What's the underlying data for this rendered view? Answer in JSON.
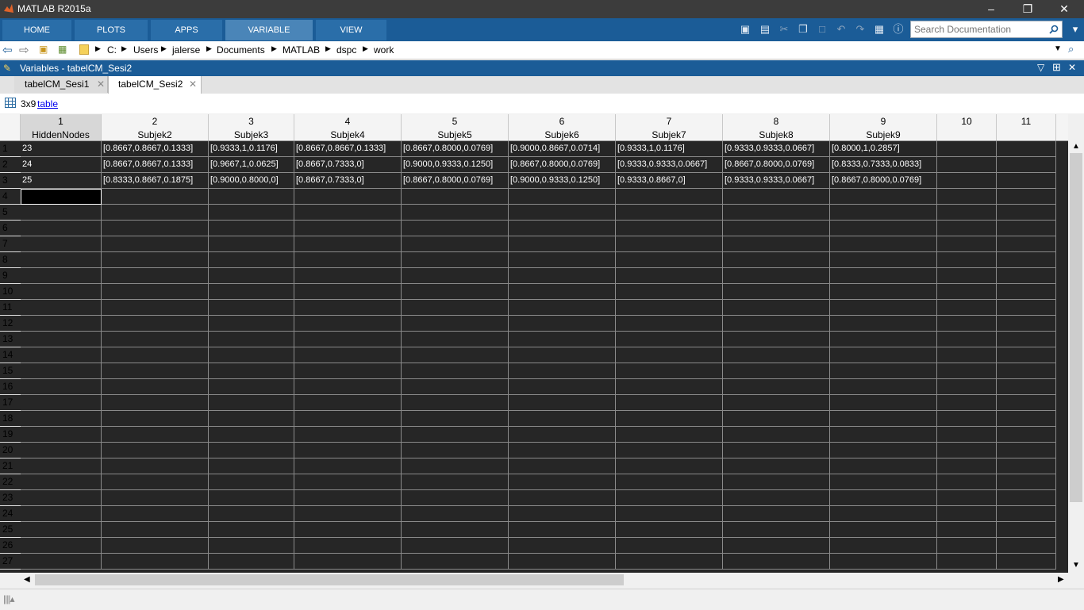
{
  "window": {
    "title": "MATLAB R2015a"
  },
  "ribbon": {
    "tabs": [
      "HOME",
      "PLOTS",
      "APPS",
      "VARIABLE",
      "VIEW"
    ],
    "active": "VARIABLE"
  },
  "search": {
    "placeholder": "Search Documentation"
  },
  "path": {
    "crumbs": [
      "C:",
      "Users",
      "jalerse",
      "Documents",
      "MATLAB",
      "dspc",
      "work"
    ]
  },
  "panel": {
    "title": "Variables - tabelCM_Sesi2"
  },
  "doc_tabs": [
    {
      "label": "tabelCM_Sesi1",
      "active": false
    },
    {
      "label": "tabelCM_Sesi2",
      "active": true
    }
  ],
  "info": {
    "size": "3x9",
    "type_link": "table"
  },
  "table": {
    "columns": [
      {
        "num": "1",
        "name": "HiddenNodes"
      },
      {
        "num": "2",
        "name": "Subjek2"
      },
      {
        "num": "3",
        "name": "Subjek3"
      },
      {
        "num": "4",
        "name": "Subjek4"
      },
      {
        "num": "5",
        "name": "Subjek5"
      },
      {
        "num": "6",
        "name": "Subjek6"
      },
      {
        "num": "7",
        "name": "Subjek7"
      },
      {
        "num": "8",
        "name": "Subjek8"
      },
      {
        "num": "9",
        "name": "Subjek9"
      },
      {
        "num": "10",
        "name": ""
      },
      {
        "num": "11",
        "name": ""
      }
    ],
    "row_numbers": [
      "1",
      "2",
      "3",
      "4",
      "5",
      "6",
      "7",
      "8",
      "9",
      "10",
      "11",
      "12",
      "13",
      "14",
      "15",
      "16",
      "17",
      "18",
      "19",
      "20",
      "21",
      "22",
      "23",
      "24",
      "25",
      "26",
      "27"
    ],
    "rows": [
      [
        "23",
        "[0.8667,0.8667,0.1333]",
        "[0.9333,1,0.1176]",
        "[0.8667,0.8667,0.1333]",
        "[0.8667,0.8000,0.0769]",
        "[0.9000,0.8667,0.0714]",
        "[0.9333,1,0.1176]",
        "[0.9333,0.9333,0.0667]",
        "[0.8000,1,0.2857]"
      ],
      [
        "24",
        "[0.8667,0.8667,0.1333]",
        "[0.9667,1,0.0625]",
        "[0.8667,0.7333,0]",
        "[0.9000,0.9333,0.1250]",
        "[0.8667,0.8000,0.0769]",
        "[0.9333,0.9333,0.0667]",
        "[0.8667,0.8000,0.0769]",
        "[0.8333,0.7333,0.0833]"
      ],
      [
        "25",
        "[0.8333,0.8667,0.1875]",
        "[0.9000,0.8000,0]",
        "[0.8667,0.7333,0]",
        "[0.8667,0.8000,0.0769]",
        "[0.9000,0.9333,0.1250]",
        "[0.9333,0.8667,0]",
        "[0.9333,0.9333,0.0667]",
        "[0.8667,0.8000,0.0769]"
      ]
    ],
    "selected_cell": {
      "row": 4,
      "col": 1
    }
  },
  "colors": {
    "ribbon": "#1b5c97",
    "grid_bg": "#262626",
    "titlebar": "#3c3c3c"
  }
}
